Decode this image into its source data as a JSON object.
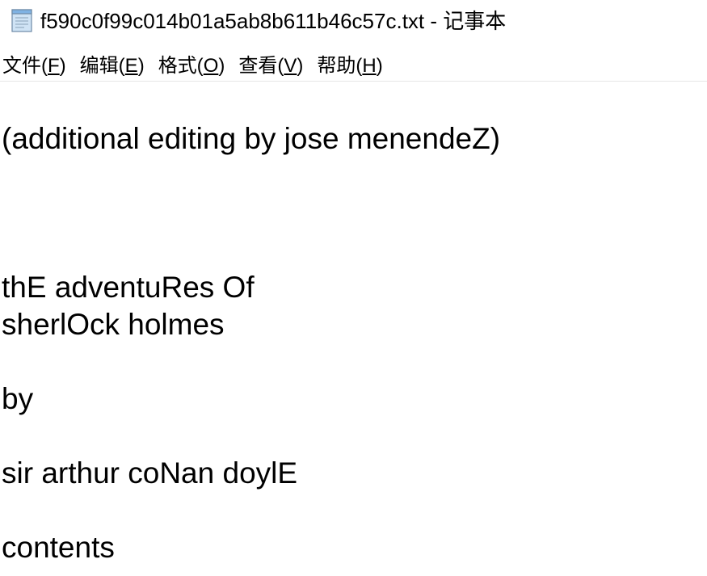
{
  "window": {
    "title": "f590c0f99c014b01a5ab8b611b46c57c.txt - 记事本",
    "icon": "notepad-icon"
  },
  "menu": [
    {
      "label": "文件(",
      "key": "F",
      "close": ")"
    },
    {
      "label": "编辑(",
      "key": "E",
      "close": ")"
    },
    {
      "label": "格式(",
      "key": "O",
      "close": ")"
    },
    {
      "label": "查看(",
      "key": "V",
      "close": ")"
    },
    {
      "label": "帮助(",
      "key": "H",
      "close": ")"
    }
  ],
  "document": {
    "lines": [
      "(additional editing by jose menendeZ)",
      "thE adventuRes Of",
      "sherlOck holmes",
      "by",
      "sir arthur coNan doylE",
      "contents"
    ]
  }
}
